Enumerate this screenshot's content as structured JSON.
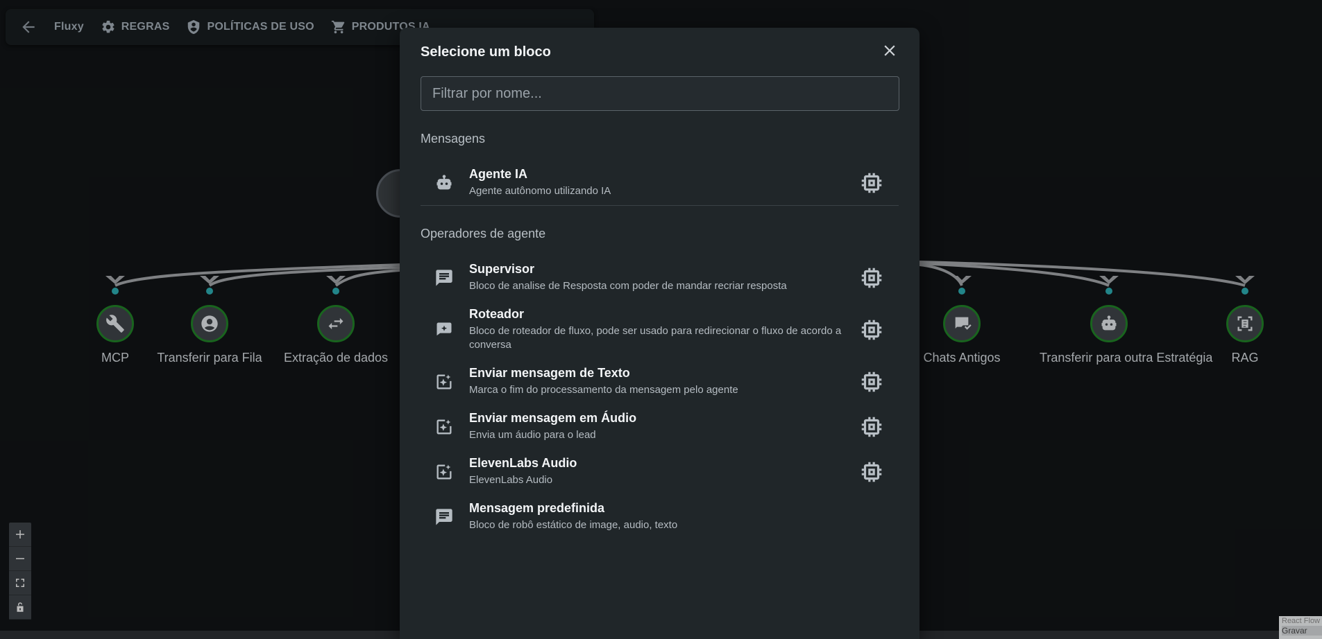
{
  "toolbar": {
    "app_name": "Fluxy",
    "rules_label": "REGRAS",
    "policies_label": "POLÍTICAS DE USO",
    "products_label": "PRODUTOS IA"
  },
  "nodes": [
    {
      "label": "MCP",
      "icon": "wrench-icon"
    },
    {
      "label": "Transferir para Fila",
      "icon": "user-icon"
    },
    {
      "label": "Extração de dados",
      "icon": "swap-icon"
    },
    {
      "label": "Chats Antigos",
      "icon": "chat-check-icon"
    },
    {
      "label": "Transferir para outra Estratégia",
      "icon": "robot-icon"
    },
    {
      "label": "RAG",
      "icon": "document-scan-icon"
    }
  ],
  "modal": {
    "title": "Selecione um bloco",
    "filter_placeholder": "Filtrar por nome...",
    "sections": [
      {
        "title": "Mensagens",
        "items": [
          {
            "title": "Agente IA",
            "desc": "Agente autônomo utilizando IA",
            "icon": "robot-icon"
          }
        ]
      },
      {
        "title": "Operadores de agente",
        "items": [
          {
            "title": "Supervisor",
            "desc": "Bloco de analise de Resposta com poder de mandar recriar resposta",
            "icon": "message-icon"
          },
          {
            "title": "Roteador",
            "desc": "Bloco de roteador de fluxo, pode ser usado para redirecionar o fluxo de acordo a conversa",
            "icon": "sparkle-icon"
          },
          {
            "title": "Enviar mensagem de Texto",
            "desc": "Marca o fim do processamento da mensagem pelo agente",
            "icon": "image-sparkle-icon"
          },
          {
            "title": "Enviar mensagem em Áudio",
            "desc": "Envia um áudio para o lead",
            "icon": "image-sparkle-icon"
          },
          {
            "title": "ElevenLabs Audio",
            "desc": "ElevenLabs Audio",
            "icon": "image-sparkle-icon"
          },
          {
            "title": "Mensagem predefinida",
            "desc": "Bloco de robô estático de image, audio, texto",
            "icon": "message-icon"
          }
        ]
      }
    ]
  },
  "corner": {
    "attribution": "React Flow",
    "save": "Gravar"
  }
}
